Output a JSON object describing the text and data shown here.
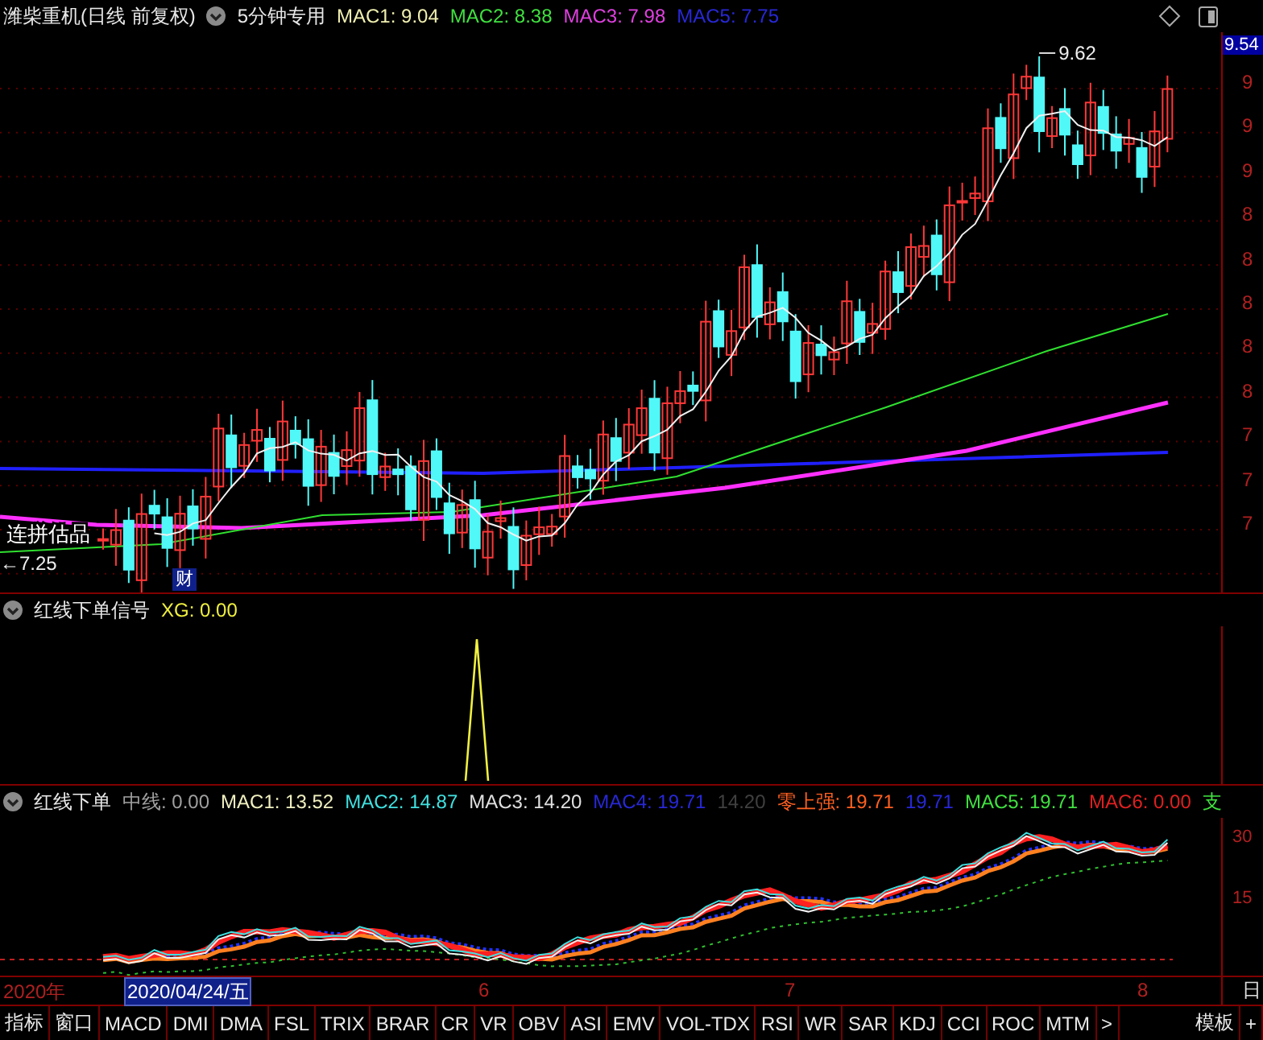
{
  "header": {
    "title": "潍柴重机(日线 前复权)",
    "formula": "5分钟专用",
    "values": [
      {
        "text": "MAC1: 9.04",
        "color": "#f0f0b0"
      },
      {
        "text": "MAC2: 8.38",
        "color": "#40e040"
      },
      {
        "text": "MAC3: 7.98",
        "color": "#e040e0"
      },
      {
        "text": "MAC5: 7.75",
        "color": "#2828d8"
      }
    ]
  },
  "price_axis": {
    "last": "9.54",
    "ticks": [
      "9",
      "9",
      "9",
      "8",
      "8",
      "8",
      "8",
      "8",
      "7",
      "7",
      "7"
    ]
  },
  "main_chart": {
    "high_label": "9.62",
    "low_label": "←7.25",
    "annotation": "连拼估品",
    "event_badge": "财"
  },
  "signal_panel": {
    "title": "红线下单信号",
    "values": [
      {
        "text": "XG: 0.00",
        "color": "#f0f040"
      }
    ]
  },
  "indicator_panel": {
    "title": "红线下单",
    "values": [
      {
        "text": "中线: 0.00",
        "color": "#a0a0a0"
      },
      {
        "text": "MAC1: 13.52",
        "color": "#f0f0c0"
      },
      {
        "text": "MAC2: 14.87",
        "color": "#40e0e0"
      },
      {
        "text": "MAC3: 14.20",
        "color": "#e0e0e0"
      },
      {
        "text": "MAC4: 19.71",
        "color": "#2828d8"
      },
      {
        "text": "14.20",
        "color": "#404040"
      },
      {
        "text": "零上强: 19.71",
        "color": "#ff6020"
      },
      {
        "text": "19.71",
        "color": "#2828d8"
      },
      {
        "text": "MAC5: 19.71",
        "color": "#40e040"
      },
      {
        "text": "MAC6: 0.00",
        "color": "#e02020"
      },
      {
        "text": "支",
        "color": "#40e040"
      }
    ],
    "axis_ticks": [
      "30",
      "15"
    ]
  },
  "date_axis": {
    "labels": [
      "2020年",
      "6",
      "7",
      "8"
    ],
    "cursor_date": "2020/04/24/五",
    "corner": "日"
  },
  "tabs": {
    "left": [
      "指标",
      "窗口"
    ],
    "indicators": [
      "MACD",
      "DMI",
      "DMA",
      "FSL",
      "TRIX",
      "BRAR",
      "CR",
      "VR",
      "OBV",
      "ASI",
      "EMV",
      "VOL-TDX",
      "RSI",
      "WR",
      "SAR",
      "KDJ",
      "CCI",
      "ROC",
      "MTM",
      ">"
    ],
    "right": [
      "模板",
      "+"
    ]
  }
}
